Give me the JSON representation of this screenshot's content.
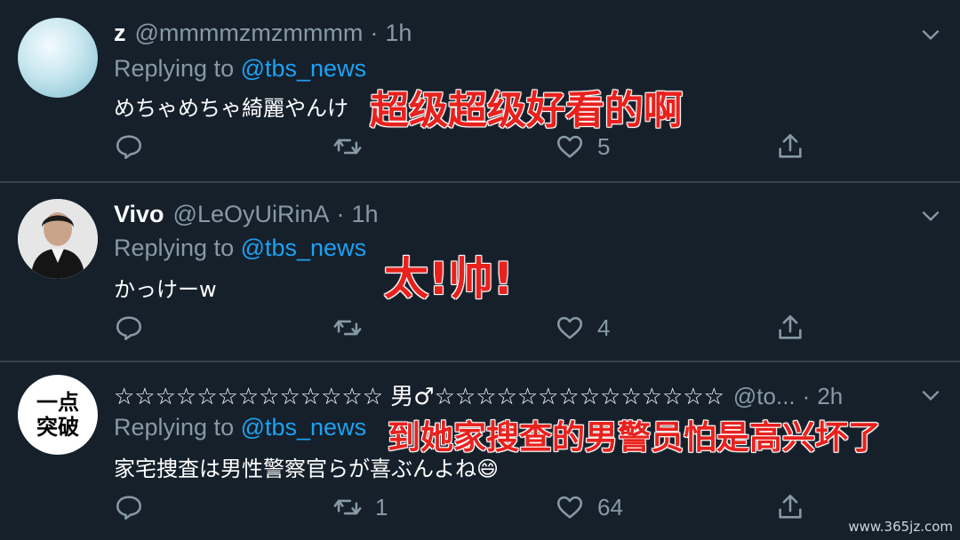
{
  "tweets": [
    {
      "name": "z",
      "handle": "@mmmmzmzmmmm",
      "dot": "·",
      "time": "1h",
      "replying_prefix": "Replying to ",
      "replying_handle": "@tbs_news",
      "text": "めちゃめちゃ綺麗やんけ",
      "overlay": "超级超级好看的啊",
      "reply_count": "",
      "retweet_count": "",
      "like_count": "5"
    },
    {
      "name": "Vivo",
      "handle": "@LeOyUiRinA",
      "dot": "·",
      "time": "1h",
      "replying_prefix": "Replying to ",
      "replying_handle": "@tbs_news",
      "text": "かっけーw",
      "overlay": "太!帅!",
      "reply_count": "",
      "retweet_count": "",
      "like_count": "4"
    },
    {
      "name": "☆☆☆☆☆☆☆☆☆☆☆☆☆ 男♂☆☆☆☆☆☆☆☆☆☆☆☆☆☆",
      "handle": "@to...",
      "dot": "·",
      "time": "2h",
      "replying_prefix": "Replying to ",
      "replying_handle": "@tbs_news",
      "text": "家宅捜査は男性警察官らが喜ぶんよね😄",
      "overlay": "到她家搜查的男警员怕是高兴坏了",
      "avatar_text": "一点 突破",
      "reply_count": "",
      "retweet_count": "1",
      "like_count": "64"
    }
  ],
  "icons": {
    "reply": "reply-icon",
    "retweet": "retweet-icon",
    "like": "heart-icon",
    "share": "share-icon",
    "menu": "chevron-down-icon"
  },
  "watermark": "www.365jz.com",
  "colors": {
    "background": "#15202b",
    "secondary_text": "#8899a6",
    "link": "#1da1f2",
    "overlay_red": "#e8211d",
    "divider": "#38444d"
  }
}
